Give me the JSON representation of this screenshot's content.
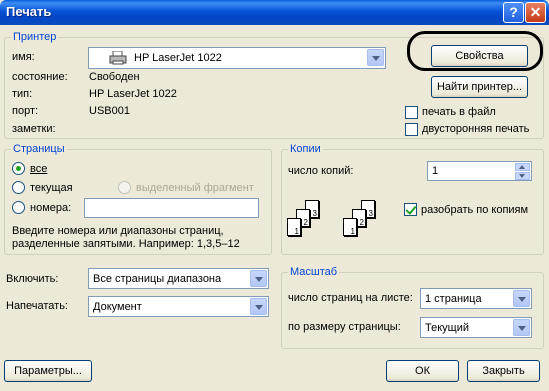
{
  "window": {
    "title": "Печать",
    "help_glyph": "?",
    "close_glyph": "✕"
  },
  "printer": {
    "legend": "Принтер",
    "name_label": "имя:",
    "name_value": "HP LaserJet 1022",
    "status_label": "состояние:",
    "status_value": "Свободен",
    "type_label": "тип:",
    "type_value": "HP LaserJet 1022",
    "port_label": "порт:",
    "port_value": "USB001",
    "notes_label": "заметки:",
    "properties_button": "Свойства",
    "find_button": "Найти принтер...",
    "print_to_file": {
      "label": "печать в файл",
      "checked": false
    },
    "duplex": {
      "label": "двусторонняя печать",
      "checked": false
    }
  },
  "pages": {
    "legend": "Страницы",
    "all": {
      "label": "все",
      "selected": true
    },
    "current": {
      "label": "текущая",
      "selected": false
    },
    "selection": {
      "label": "выделенный фрагмент",
      "enabled": false
    },
    "numbers": {
      "label": "номера:",
      "selected": false,
      "value": ""
    },
    "hint": "Введите номера или диапазоны страниц, разделенные запятыми. Например: 1,3,5–12"
  },
  "copies": {
    "legend": "Копии",
    "count_label": "число копий:",
    "count_value": "1",
    "collate": {
      "label": "разобрать по копиям",
      "checked": true
    },
    "page_numbers": [
      "1",
      "2",
      "3"
    ]
  },
  "include": {
    "label": "Включить:",
    "value": "Все страницы диапазона"
  },
  "print_what": {
    "label": "Напечатать:",
    "value": "Документ"
  },
  "zoom": {
    "legend": "Масштаб",
    "per_sheet_label": "число страниц на листе:",
    "per_sheet_value": "1 страница",
    "fit_label": "по размеру страницы:",
    "fit_value": "Текущий"
  },
  "footer": {
    "options_button": "Параметры...",
    "ok_button": "ОК",
    "cancel_button": "Закрыть"
  }
}
